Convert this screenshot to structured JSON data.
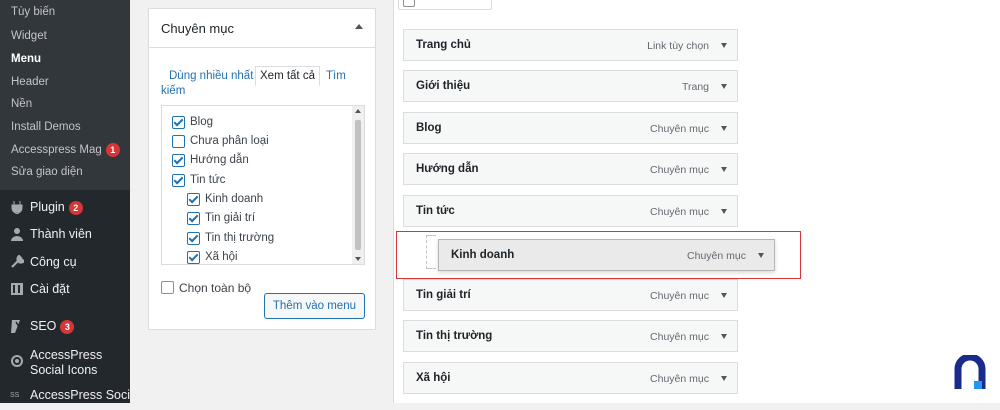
{
  "sidebar": {
    "submenu": [
      {
        "label": "Tùy biến"
      },
      {
        "label": "Widget"
      },
      {
        "label": "Menu",
        "current": true
      },
      {
        "label": "Header"
      },
      {
        "label": "Nền"
      },
      {
        "label": "Install Demos"
      },
      {
        "label": "Accesspress Mag",
        "badge": "1"
      },
      {
        "label": "Sửa giao diện"
      }
    ],
    "menu": [
      {
        "label": "Plugin",
        "badge": "2",
        "icon": "plugin-icon"
      },
      {
        "label": "Thành viên",
        "icon": "user-icon"
      },
      {
        "label": "Công cụ",
        "icon": "wrench-icon"
      },
      {
        "label": "Cài đặt",
        "icon": "settings-icon"
      },
      {
        "label": "SEO",
        "badge": "3",
        "icon": "yoast-icon"
      },
      {
        "label1": "AccessPress",
        "label2": "Social Icons",
        "icon": "social-icons-icon"
      },
      {
        "label1": "AccessPress Social",
        "label2": "",
        "icon": "social-share-icon"
      }
    ]
  },
  "panel": {
    "title": "Chuyên mục",
    "tabs": {
      "most_used": "Dùng nhiều nhất",
      "view_all": "Xem tất cả",
      "search": "Tìm",
      "search2": "kiếm"
    },
    "categories": [
      {
        "label": "Blog",
        "checked": true
      },
      {
        "label": "Chưa phân loại",
        "checked": false
      },
      {
        "label": "Hướng dẫn",
        "checked": true
      },
      {
        "label": "Tin tức",
        "checked": true
      },
      {
        "label": "Kinh doanh",
        "checked": true
      },
      {
        "label": "Tin giải trí",
        "checked": true
      },
      {
        "label": "Tin thị trường",
        "checked": true
      },
      {
        "label": "Xã hội",
        "checked": true
      }
    ],
    "select_all": "Chọn toàn bộ",
    "add_button": "Thêm vào menu"
  },
  "structure": {
    "items": [
      {
        "title": "Trang chủ",
        "kind": "Link tùy chọn"
      },
      {
        "title": "Giới thiệu",
        "kind": "Trang"
      },
      {
        "title": "Blog",
        "kind": "Chuyên mục"
      },
      {
        "title": "Hướng dẫn",
        "kind": "Chuyên mục"
      },
      {
        "title": "Tin tức",
        "kind": "Chuyên mục"
      },
      {
        "title": "Tin giải trí",
        "kind": "Chuyên mục"
      },
      {
        "title": "Tin thị trường",
        "kind": "Chuyên mục"
      },
      {
        "title": "Xã hội",
        "kind": "Chuyên mục"
      }
    ],
    "dragging": {
      "title": "Kinh doanh",
      "kind": "Chuyên mục"
    }
  },
  "colors": {
    "sidebar": "#23282d",
    "accent": "#2271b1",
    "highlight": "#d63638"
  }
}
